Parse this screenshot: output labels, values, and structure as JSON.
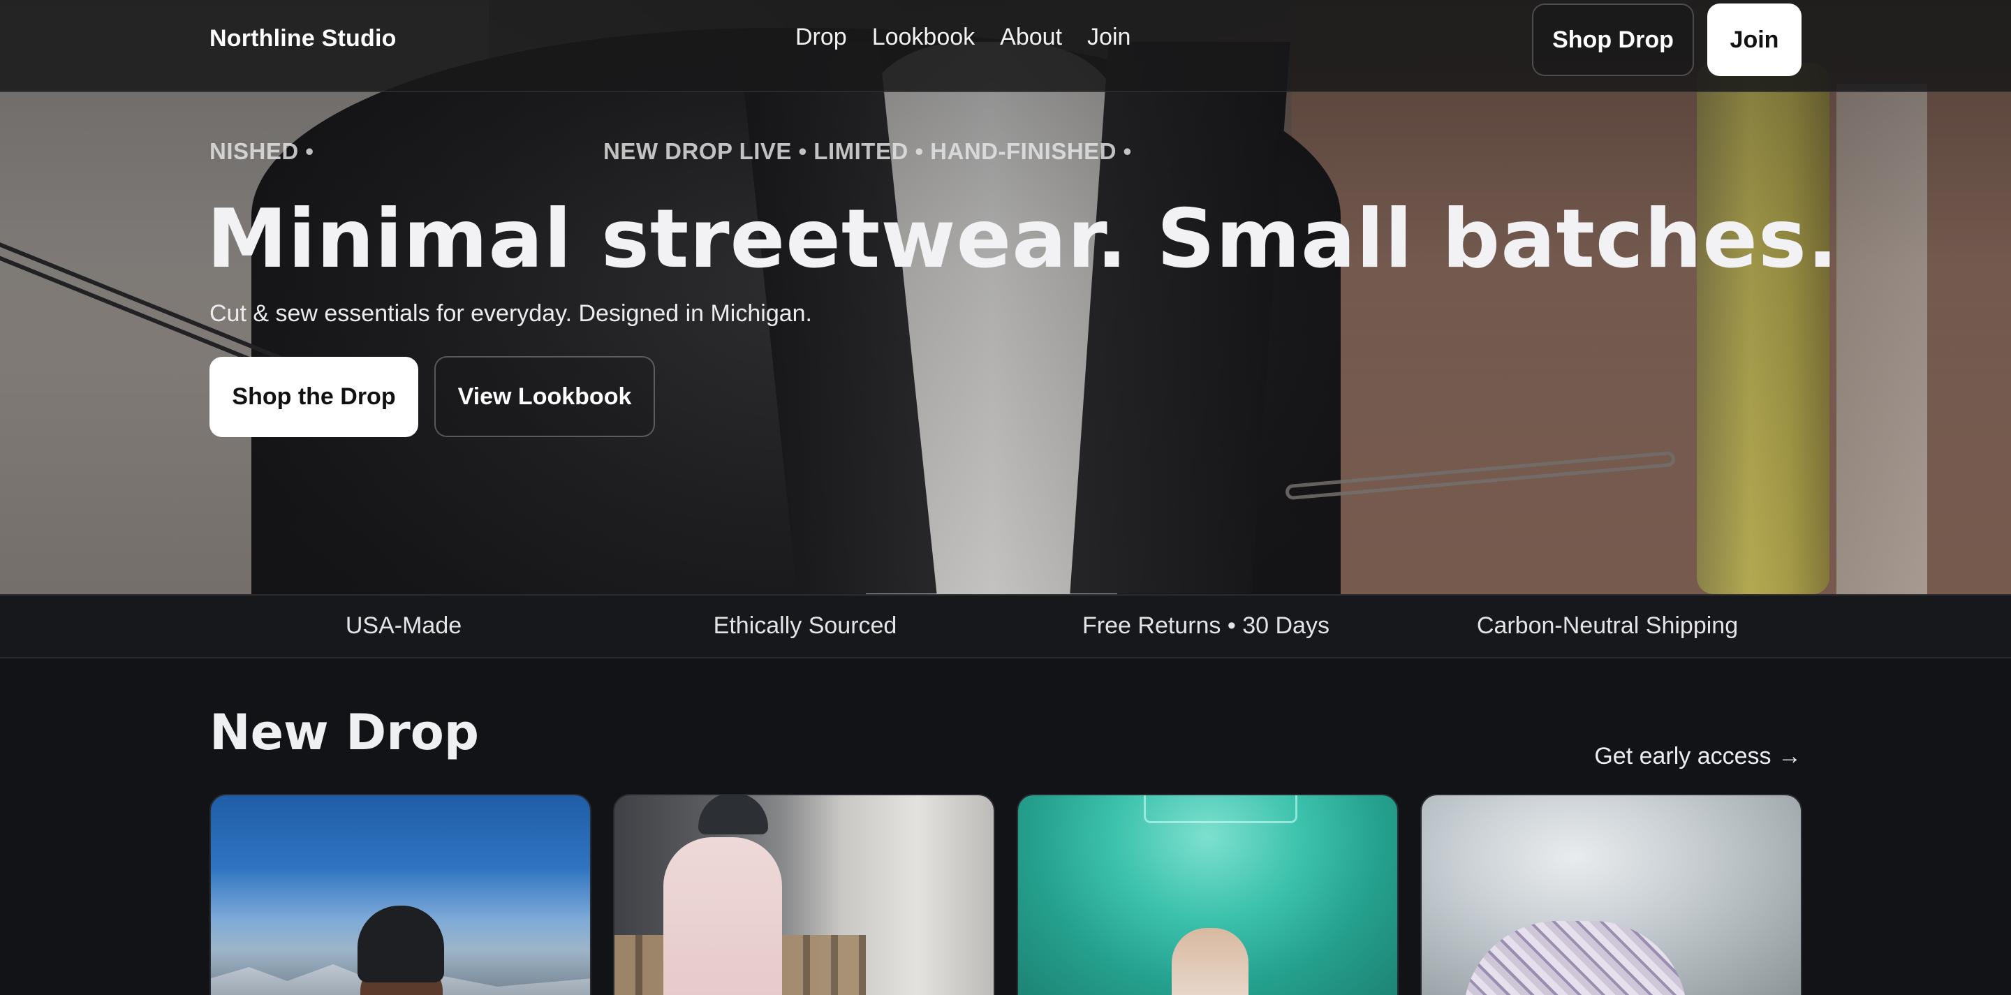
{
  "nav": {
    "brand": "Northline Studio",
    "links": [
      "Drop",
      "Lookbook",
      "About",
      "Join"
    ],
    "shop_drop_label": "Shop Drop",
    "join_label": "Join"
  },
  "hero": {
    "marquee_fragment": "NISHED •",
    "marquee_text": "NEW DROP LIVE • LIMITED • HAND-FINISHED •",
    "title": "Minimal streetwear. Small batches.",
    "subtitle": "Cut & sew essentials for everyday. Designed in Michigan.",
    "primary_cta": "Shop the Drop",
    "secondary_cta": "View Lookbook"
  },
  "features": [
    "USA-Made",
    "Ethically Sourced",
    "Free Returns • 30 Days",
    "Carbon-Neutral Shipping"
  ],
  "new_drop": {
    "title": "New Drop",
    "early_access_link": "Get early access →",
    "cards": [
      {
        "image": "man-in-black-beanie-mountains"
      },
      {
        "image": "man-in-pink-sweatshirt-pallets"
      },
      {
        "image": "woman-teal-neon-wall"
      },
      {
        "image": "knit-beanie-snow"
      }
    ]
  },
  "colors": {
    "background": "#121317",
    "nav_bg": "#18181a",
    "primary_button_bg": "#ffffff",
    "text": "#f2f2f4"
  }
}
